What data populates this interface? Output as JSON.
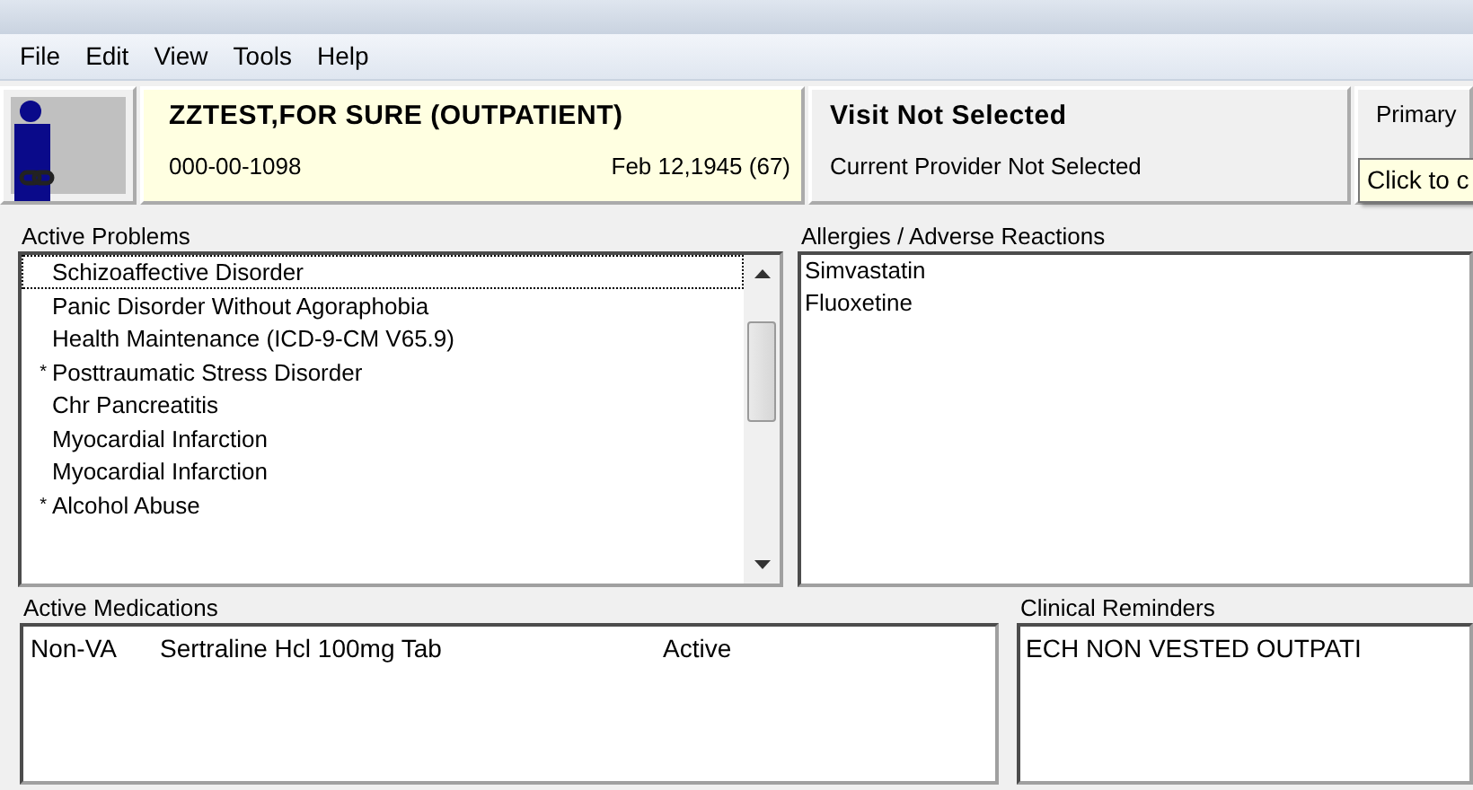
{
  "menu": [
    "File",
    "Edit",
    "View",
    "Tools",
    "Help"
  ],
  "patient": {
    "name": "ZZTEST,FOR SURE (OUTPATIENT)",
    "ssn": "000-00-1098",
    "dob": "Feb 12,1945 (67)"
  },
  "visit": {
    "title": "Visit Not Selected",
    "provider": "Current Provider Not Selected"
  },
  "primary_care": {
    "label": "Primary"
  },
  "tooltip": "Click to c",
  "active_problems": {
    "label": "Active Problems",
    "items": [
      {
        "text": "Schizoaffective Disorder",
        "selected": true
      },
      {
        "text": "Panic Disorder Without Agoraphobia",
        "selected": false
      },
      {
        "text": "Health Maintenance (ICD-9-CM V65.9)",
        "selected": false
      },
      {
        "marker": "*",
        "text": "Posttraumatic Stress Disorder",
        "selected": false
      },
      {
        "text": "Chr Pancreatitis",
        "selected": false
      },
      {
        "text": "Myocardial Infarction",
        "selected": false
      },
      {
        "text": "Myocardial Infarction",
        "selected": false
      },
      {
        "marker": "*",
        "text": "Alcohol Abuse",
        "selected": false
      }
    ]
  },
  "allergies": {
    "label": "Allergies / Adverse Reactions",
    "items": [
      "Simvastatin",
      "Fluoxetine"
    ]
  },
  "active_medications": {
    "label": "Active Medications",
    "rows": [
      {
        "type": "Non-VA",
        "drug": "Sertraline Hcl 100mg Tab",
        "status": "Active"
      }
    ]
  },
  "clinical_reminders": {
    "label": "Clinical Reminders",
    "items": [
      "ECH NON VESTED OUTPATI"
    ]
  }
}
